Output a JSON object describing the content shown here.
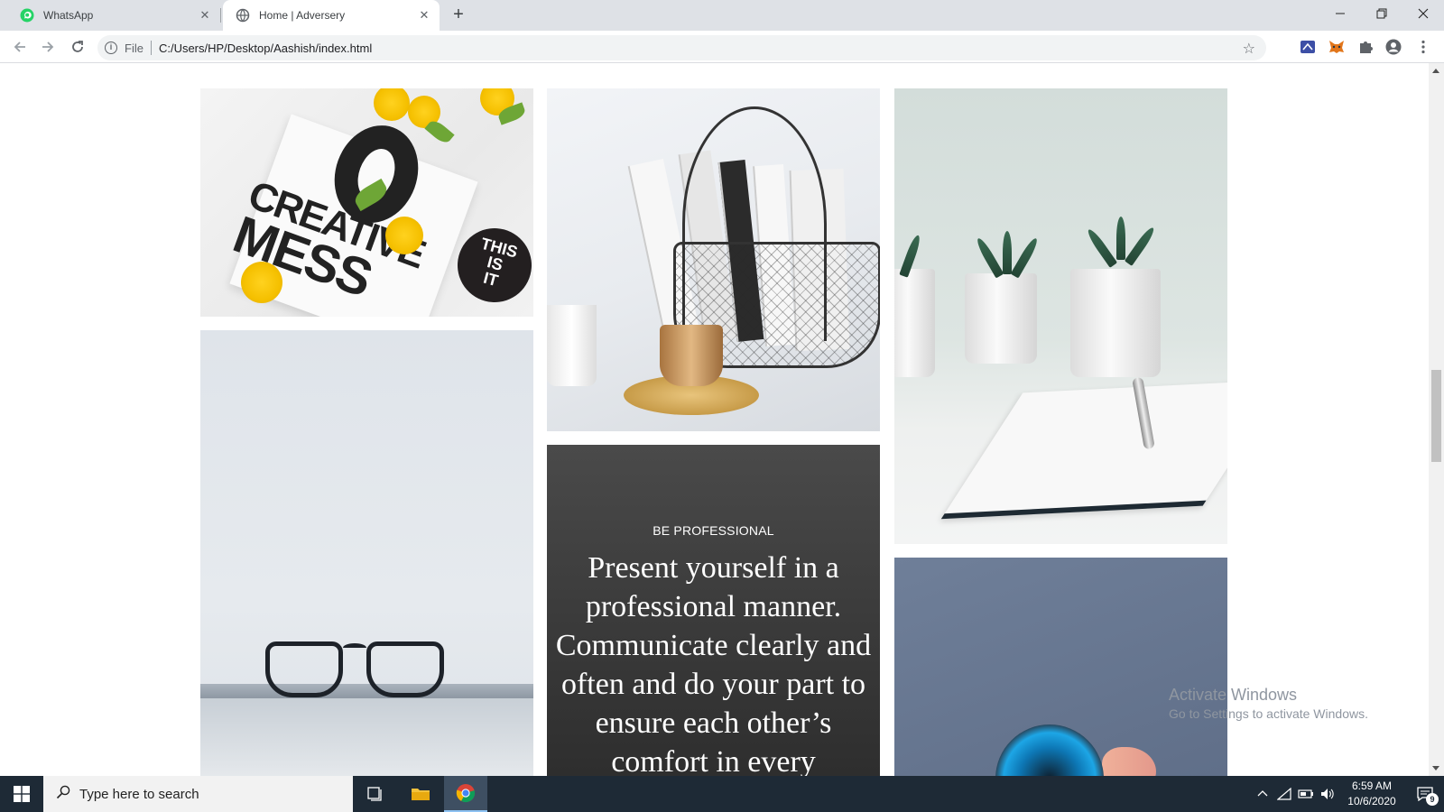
{
  "browser": {
    "tabs": [
      {
        "title": "WhatsApp",
        "icon": "whatsapp-icon",
        "active": false
      },
      {
        "title": "Home | Adversery",
        "icon": "globe-icon",
        "active": true
      }
    ],
    "address": {
      "scheme_label": "File",
      "url": "C:/Users/HP/Desktop/Aashish/index.html"
    },
    "toolbar_icons": [
      "back-arrow-icon",
      "forward-arrow-icon",
      "reload-icon",
      "info-icon",
      "star-icon",
      "cast-extension-icon",
      "metamask-fox-icon",
      "puzzle-extensions-icon",
      "profile-icon",
      "more-vertical-icon"
    ],
    "window_controls": [
      "minimize-icon",
      "restore-icon",
      "close-icon"
    ]
  },
  "page": {
    "gallery": [
      {
        "id": "creative-mess",
        "texts": [
          "CREATIVE",
          "MESS",
          "THIS",
          "IS",
          "IT"
        ]
      },
      {
        "id": "basket-books-coffee"
      },
      {
        "id": "succulents-notebook"
      },
      {
        "id": "glasses-laptop"
      },
      {
        "id": "watch-hand"
      }
    ],
    "quote": {
      "kicker": "BE PROFESSIONAL",
      "text": "Present yourself in a professional manner. Communicate clearly and often and do your part to ensure each other’s comfort in every"
    }
  },
  "watermark": {
    "line1": "Activate Windows",
    "line2": "Go to Settings to activate Windows."
  },
  "taskbar": {
    "search_placeholder": "Type here to search",
    "apps": [
      "task-view-icon",
      "file-explorer-icon",
      "chrome-icon"
    ],
    "tray_icons": [
      "chevron-up-icon",
      "network-icon",
      "battery-icon",
      "volume-icon"
    ],
    "time": "6:59 AM",
    "date": "10/6/2020",
    "notification_count": "9"
  },
  "colors": {
    "taskbar_bg": "#1e2a36",
    "tabstrip_bg": "#dee1e6",
    "quote_tile_bg": "#3e3e3e",
    "whatsapp_green": "#25d366"
  }
}
